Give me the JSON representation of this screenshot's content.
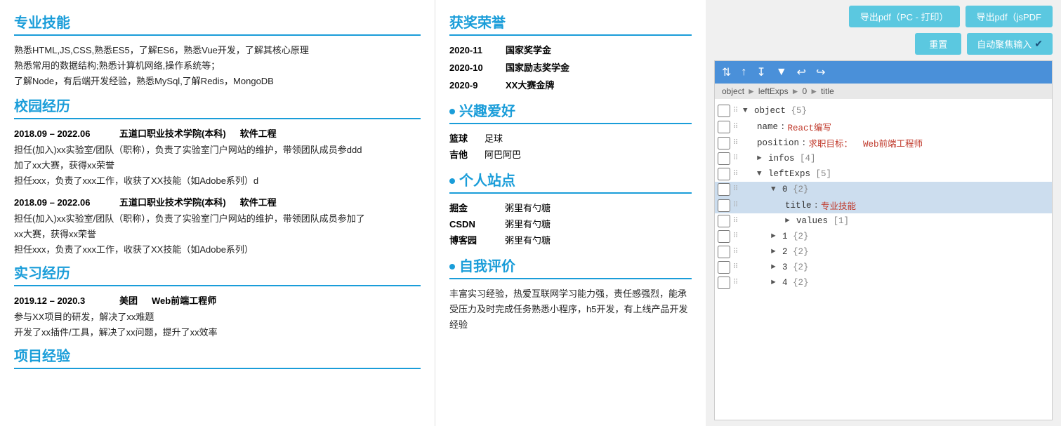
{
  "resume": {
    "left_sections": [
      {
        "id": "skills",
        "title": "专业技能",
        "content": [
          "熟悉HTML,JS,CSS,熟悉ES5，了解ES6，熟悉Vue开发，了解其核心原理",
          "熟悉常用的数据结构;熟悉计算机网络,操作系统等；",
          "了解Node，有后端开发经验，熟悉MySql,了解Redis，MongoDB"
        ]
      },
      {
        "id": "campus",
        "title": "校园经历",
        "experiences": [
          {
            "date": "2018.09 – 2022.06",
            "school": "五道口职业技术学院(本科)",
            "major": "软件工程",
            "desc": [
              "担任(加入)xx实验室/团队（职称），负责了实验室门户网站的维护，带领团队成员参ddd",
              "加了xx大赛，获得xx荣誉",
              "担任xxx，负责了xxx工作，收获了XX技能（如Adobe系列）d"
            ]
          },
          {
            "date": "2018.09 – 2022.06",
            "school": "五道口职业技术学院(本科)",
            "major": "软件工程",
            "desc": [
              "担任(加入)xx实验室/团队（职称），负责了实验室门户网站的维护，带领团队成员参加了",
              "xx大赛，获得xx荣誉",
              "担任xxx，负责了xxx工作，收获了XX技能（如Adobe系列）"
            ]
          }
        ]
      },
      {
        "id": "intern",
        "title": "实习经历",
        "experiences": [
          {
            "date": "2019.12 – 2020.3",
            "company": "美团",
            "position": "Web前端工程师",
            "desc": [
              "参与XX项目的研发，解决了xx难题",
              "开发了xx插件/工具，解决了xx问题，提升了xx效率"
            ]
          }
        ]
      },
      {
        "id": "project",
        "title": "项目经验"
      }
    ],
    "right_sections": [
      {
        "id": "awards",
        "title": "获奖荣誉",
        "items": [
          {
            "date": "2020-11",
            "name": "国家奖学金"
          },
          {
            "date": "2020-10",
            "name": "国家励志奖学金"
          },
          {
            "date": "2020-9",
            "name": "XX大赛金牌"
          }
        ]
      },
      {
        "id": "hobbies",
        "title": "兴趣爱好",
        "items": [
          {
            "key": "篮球",
            "value": "足球"
          },
          {
            "key": "吉他",
            "value": "阿巴阿巴"
          }
        ]
      },
      {
        "id": "sites",
        "title": "个人站点",
        "items": [
          {
            "key": "掘金",
            "value": "粥里有勺糖"
          },
          {
            "key": "CSDN",
            "value": "粥里有勺糖"
          },
          {
            "key": "博客园",
            "value": "粥里有勺糖"
          }
        ]
      },
      {
        "id": "self_eval",
        "title": "自我评价",
        "content": "丰富实习经验，热爱互联网学习能力强，责任感强烈，能承受压力及时完成任务熟悉小程序，h5开发，有上线产品开发经验"
      }
    ]
  },
  "editor": {
    "export_pdf_pc": "导出pdf（PC - 打印）",
    "export_pdf_jspdf": "导出pdf（jsPDF",
    "reset_label": "重置",
    "auto_focus_label": "自动聚焦输入",
    "breadcrumb": [
      "object",
      "leftExps",
      "0",
      "title"
    ],
    "toolbar_icons": [
      "swap-icon",
      "arrow-up-icon",
      "sort-icon",
      "filter-icon",
      "undo-icon",
      "redo-icon"
    ],
    "tree": [
      {
        "indent": 0,
        "toggle": "▼",
        "key": "object",
        "meta": "{5}",
        "level": 0
      },
      {
        "indent": 1,
        "key": "name",
        "colon": ":",
        "value": "React编写",
        "type": "string",
        "level": 1
      },
      {
        "indent": 1,
        "key": "position",
        "colon": ":",
        "value": "求职目标：  Web前端工程师",
        "type": "string",
        "level": 1
      },
      {
        "indent": 1,
        "toggle": "►",
        "key": "infos",
        "meta": "[4]",
        "level": 1
      },
      {
        "indent": 1,
        "toggle": "▼",
        "key": "leftExps",
        "meta": "[5]",
        "level": 1
      },
      {
        "indent": 2,
        "toggle": "▼",
        "key": "0",
        "meta": "{2}",
        "level": 2,
        "highlight": true
      },
      {
        "indent": 3,
        "key": "title",
        "colon": ":",
        "value": "专业技能",
        "type": "string",
        "level": 3,
        "highlight": true
      },
      {
        "indent": 3,
        "toggle": "►",
        "key": "values",
        "meta": "[1]",
        "level": 3
      },
      {
        "indent": 2,
        "toggle": "►",
        "key": "1",
        "meta": "{2}",
        "level": 2
      },
      {
        "indent": 2,
        "toggle": "►",
        "key": "2",
        "meta": "{2}",
        "level": 2
      },
      {
        "indent": 2,
        "toggle": "►",
        "key": "3",
        "meta": "{2}",
        "level": 2
      },
      {
        "indent": 2,
        "toggle": "►",
        "key": "4",
        "meta": "{2}",
        "level": 2
      }
    ]
  }
}
